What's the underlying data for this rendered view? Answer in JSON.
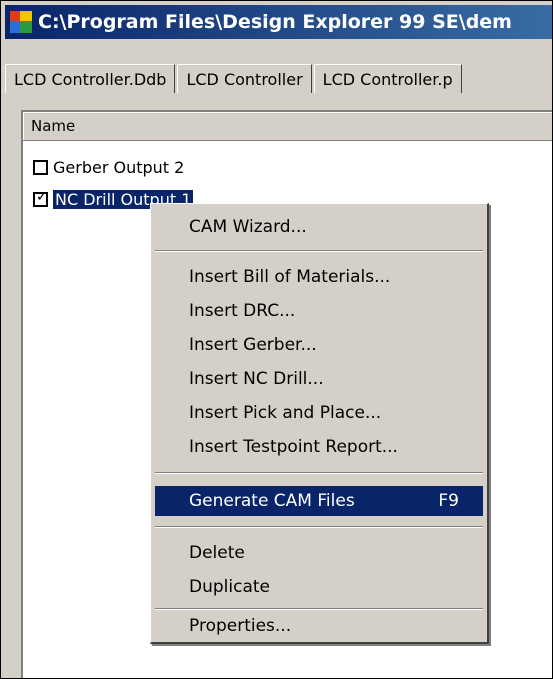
{
  "window": {
    "title": "C:\\Program Files\\Design Explorer 99 SE\\dem"
  },
  "tabs": [
    {
      "label": "LCD Controller.Ddb"
    },
    {
      "label": "LCD Controller"
    },
    {
      "label": "LCD Controller.p"
    }
  ],
  "list": {
    "column_header": "Name",
    "items": [
      {
        "label": "Gerber Output 2",
        "checked": false,
        "selected": false
      },
      {
        "label": "NC Drill Output 1",
        "checked": true,
        "selected": true
      }
    ]
  },
  "context_menu": {
    "items": [
      {
        "label": "CAM Wizard..."
      },
      {
        "label": "Insert Bill of Materials..."
      },
      {
        "label": "Insert DRC..."
      },
      {
        "label": "Insert Gerber..."
      },
      {
        "label": "Insert NC Drill..."
      },
      {
        "label": "Insert Pick and Place..."
      },
      {
        "label": "Insert Testpoint Report..."
      },
      {
        "label": "Generate CAM Files",
        "shortcut": "F9",
        "highlighted": true
      },
      {
        "label": "Delete"
      },
      {
        "label": "Duplicate"
      },
      {
        "label": "Properties..."
      }
    ]
  },
  "colors": {
    "title_bar": "#0a246a",
    "menu_highlight": "#0a246a",
    "face": "#d4d0c8"
  }
}
